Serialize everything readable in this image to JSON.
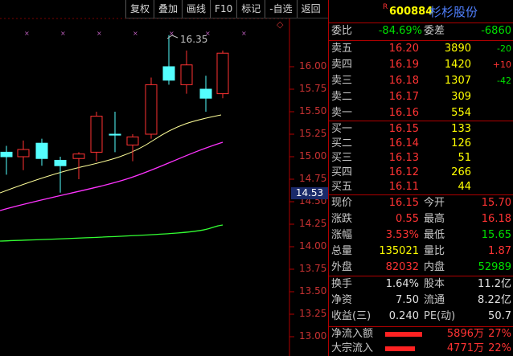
{
  "toolbar": {
    "buttons": [
      "复权",
      "叠加",
      "画线",
      "F10",
      "标记",
      "-自选",
      "返回"
    ]
  },
  "chart": {
    "y_axis_labels": [
      "16.00",
      "15.75",
      "15.50",
      "15.25",
      "15.00",
      "14.75",
      "14.50",
      "14.25",
      "14.00",
      "13.75",
      "13.50",
      "13.25",
      "13.00"
    ],
    "current_price_tag": "14.53",
    "high_annotation": "16.35",
    "colors": {
      "ma5": "#ffff99",
      "ma10": "#ff33ff",
      "ma20": "#33ff33",
      "up": "#ff3232",
      "down": "#54ffff"
    }
  },
  "header": {
    "flag": "R",
    "code": "600884",
    "name": "杉杉股份"
  },
  "weibi": {
    "label1": "委比",
    "value1": "-84.69%",
    "label2": "委差",
    "value2": "-6860"
  },
  "asks": [
    {
      "label": "卖五",
      "price": "16.20",
      "vol": "3890",
      "chg": "-20"
    },
    {
      "label": "卖四",
      "price": "16.19",
      "vol": "1420",
      "chg": "+10"
    },
    {
      "label": "卖三",
      "price": "16.18",
      "vol": "1307",
      "chg": "-42"
    },
    {
      "label": "卖二",
      "price": "16.17",
      "vol": "309",
      "chg": ""
    },
    {
      "label": "卖一",
      "price": "16.16",
      "vol": "554",
      "chg": ""
    }
  ],
  "bids": [
    {
      "label": "买一",
      "price": "16.15",
      "vol": "133"
    },
    {
      "label": "买二",
      "price": "16.14",
      "vol": "126"
    },
    {
      "label": "买三",
      "price": "16.13",
      "vol": "51"
    },
    {
      "label": "买四",
      "price": "16.12",
      "vol": "266"
    },
    {
      "label": "买五",
      "price": "16.11",
      "vol": "44"
    }
  ],
  "quote": [
    {
      "l1": "现价",
      "v1": "16.15",
      "l2": "今开",
      "v2": "15.70"
    },
    {
      "l1": "涨跌",
      "v1": "0.55",
      "l2": "最高",
      "v2": "16.18"
    },
    {
      "l1": "涨幅",
      "v1": "3.53%",
      "l2": "最低",
      "v2": "15.65"
    },
    {
      "l1": "总量",
      "v1": "135021",
      "l2": "量比",
      "v2": "1.87"
    },
    {
      "l1": "外盘",
      "v1": "82032",
      "l2": "内盘",
      "v2": "52989"
    }
  ],
  "fund": [
    {
      "l1": "换手",
      "v1": "1.64%",
      "l2": "股本",
      "v2": "11.2亿"
    },
    {
      "l1": "净资",
      "v1": "7.50",
      "l2": "流通",
      "v2": "8.22亿"
    },
    {
      "l1": "收益(三)",
      "v1": "0.240",
      "l2": "PE(动)",
      "v2": "50.7"
    }
  ],
  "flows": [
    {
      "label": "净流入额",
      "value": "5896万",
      "pct": "27%",
      "bar_fraction": 0.27
    },
    {
      "label": "大宗流入",
      "value": "4771万",
      "pct": "22%",
      "bar_fraction": 0.22
    }
  ]
}
